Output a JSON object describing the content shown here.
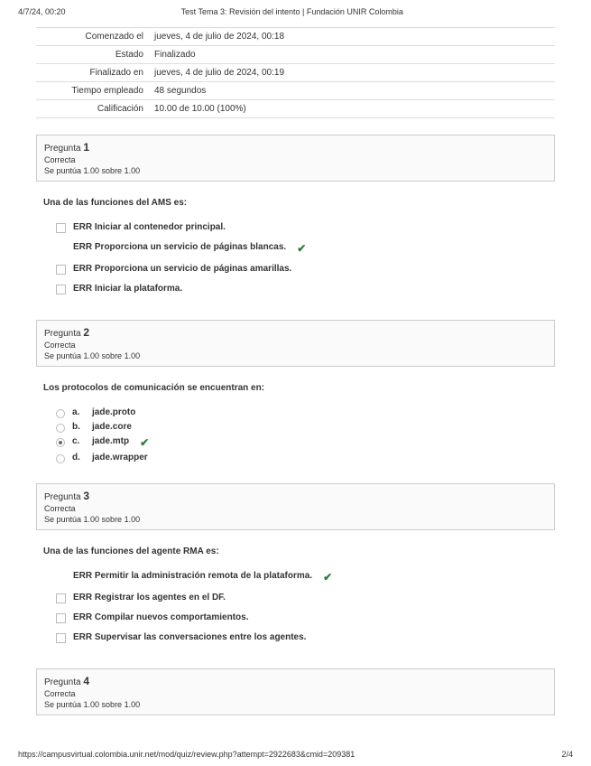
{
  "header": {
    "datetime": "4/7/24, 00:20",
    "title": "Test Tema 3: Revisión del intento | Fundación UNIR Colombia"
  },
  "summary": {
    "rows": [
      {
        "label": "Comenzado el",
        "value": "jueves, 4 de julio de 2024, 00:18"
      },
      {
        "label": "Estado",
        "value": "Finalizado"
      },
      {
        "label": "Finalizado en",
        "value": "jueves, 4 de julio de 2024, 00:19"
      },
      {
        "label": "Tiempo empleado",
        "value": "48 segundos"
      },
      {
        "label": "Calificación",
        "value": "10.00 de 10.00 (100%)"
      }
    ]
  },
  "strings": {
    "pregunta": "Pregunta",
    "correcta": "Correcta",
    "puntua": "Se puntúa 1.00 sobre 1.00"
  },
  "questions": [
    {
      "num": "1",
      "text": "Una de las funciones del AMS es:",
      "type": "checkbox",
      "options": [
        {
          "text": "ERR Iniciar al contenedor principal.",
          "checked": false,
          "correct": false,
          "showbox": true
        },
        {
          "text": "ERR Proporciona un servicio de páginas blancas.",
          "checked": false,
          "correct": true,
          "showbox": false
        },
        {
          "text": "ERR Proporciona un servicio de páginas amarillas.",
          "checked": false,
          "correct": false,
          "showbox": true
        },
        {
          "text": "ERR Iniciar la plataforma.",
          "checked": false,
          "correct": false,
          "showbox": true
        }
      ]
    },
    {
      "num": "2",
      "text": "Los protocolos de comunicación se encuentran en:",
      "type": "radio",
      "options": [
        {
          "letter": "a.",
          "text": "jade.proto",
          "selected": false,
          "correct": false
        },
        {
          "letter": "b.",
          "text": "jade.core",
          "selected": false,
          "correct": false
        },
        {
          "letter": "c.",
          "text": "jade.mtp",
          "selected": true,
          "correct": true
        },
        {
          "letter": "d.",
          "text": "jade.wrapper",
          "selected": false,
          "correct": false
        }
      ]
    },
    {
      "num": "3",
      "text": "Una de las funciones del agente RMA es:",
      "type": "checkbox",
      "options": [
        {
          "text": "ERR Permitir la administración remota de la plataforma.",
          "checked": false,
          "correct": true,
          "showbox": false
        },
        {
          "text": "ERR Registrar los agentes en el DF.",
          "checked": false,
          "correct": false,
          "showbox": true
        },
        {
          "text": "ERR Compilar nuevos comportamientos.",
          "checked": false,
          "correct": false,
          "showbox": true
        },
        {
          "text": "ERR Supervisar las conversaciones entre los agentes.",
          "checked": false,
          "correct": false,
          "showbox": true
        }
      ]
    },
    {
      "num": "4",
      "text": "",
      "type": "header-only"
    }
  ],
  "footer": {
    "url": "https://campusvirtual.colombia.unir.net/mod/quiz/review.php?attempt=2922683&cmid=209381",
    "page": "2/4"
  }
}
